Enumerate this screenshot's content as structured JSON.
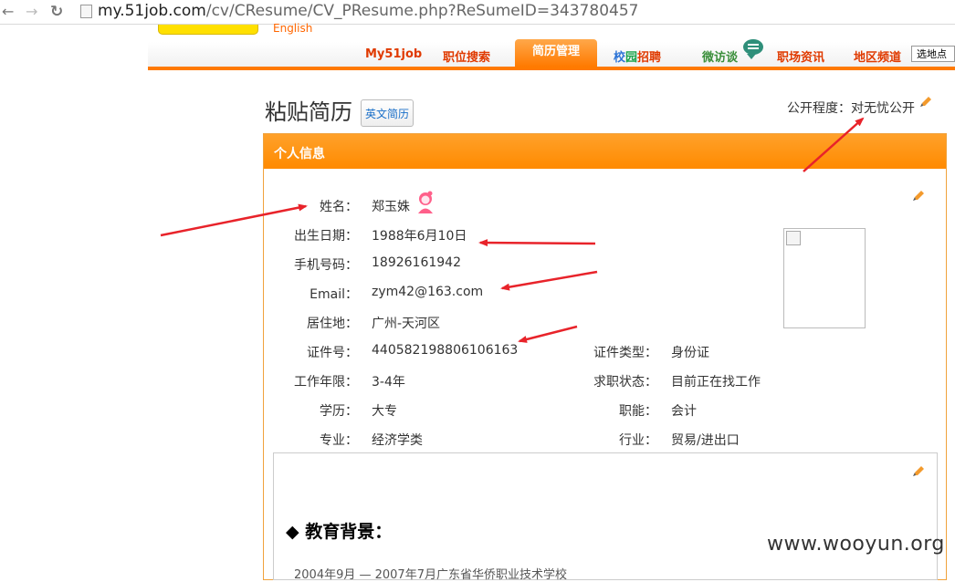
{
  "browser": {
    "url_host": "my.51job.com",
    "url_path": "/cv/CResume/CV_PResume.php?ReSumeID=343780457"
  },
  "site": {
    "english_link": "English",
    "nav": {
      "my51job": "My51job",
      "job_search": "职位搜索",
      "resume_manage": "简历管理",
      "campus": [
        "校",
        "园",
        "招",
        "聘"
      ],
      "weifangtan": "微访谈",
      "career_news": "职场资讯",
      "regional": "地区频道",
      "region_select": "选地点"
    }
  },
  "page": {
    "title": "粘贴简历",
    "english_resume_button": "英文简历",
    "privacy": "公开程度：对无忧公开"
  },
  "personal_info": {
    "section_title": "个人信息",
    "fields_left": [
      {
        "label": "姓名：",
        "value": "郑玉姝"
      },
      {
        "label": "出生日期：",
        "value": "1988年6月10日"
      },
      {
        "label": "手机号码：",
        "value": "18926161942"
      },
      {
        "label": "Email：",
        "value": "zym42@163.com"
      },
      {
        "label": "居住地：",
        "value": "广州-天河区"
      },
      {
        "label": "证件号：",
        "value": "440582198806106163"
      },
      {
        "label": "工作年限：",
        "value": "3-4年"
      },
      {
        "label": "学历：",
        "value": "大专"
      },
      {
        "label": "专业：",
        "value": "经济学类"
      }
    ],
    "fields_right": [
      {
        "label": "证件类型：",
        "value": "身份证"
      },
      {
        "label": "求职状态：",
        "value": "目前正在找工作"
      },
      {
        "label": "职能：",
        "value": "会计"
      },
      {
        "label": "行业：",
        "value": "贸易/进出口"
      }
    ]
  },
  "education": {
    "heading": "◆ 教育背景：",
    "row_partial": "2004年9月 — 2007年7月广东省华侨职业技术学校"
  },
  "watermark": "www.wooyun.org",
  "colors": {
    "accent_orange": "#ff8a00",
    "nav_text": "#e03a00",
    "annotation_red": "#e8232a"
  },
  "icons": [
    "back-arrow-icon",
    "forward-arrow-icon",
    "reload-icon",
    "page-icon",
    "chat-bubble-icon",
    "pencil-icon",
    "female-avatar-icon",
    "broken-image-icon"
  ]
}
